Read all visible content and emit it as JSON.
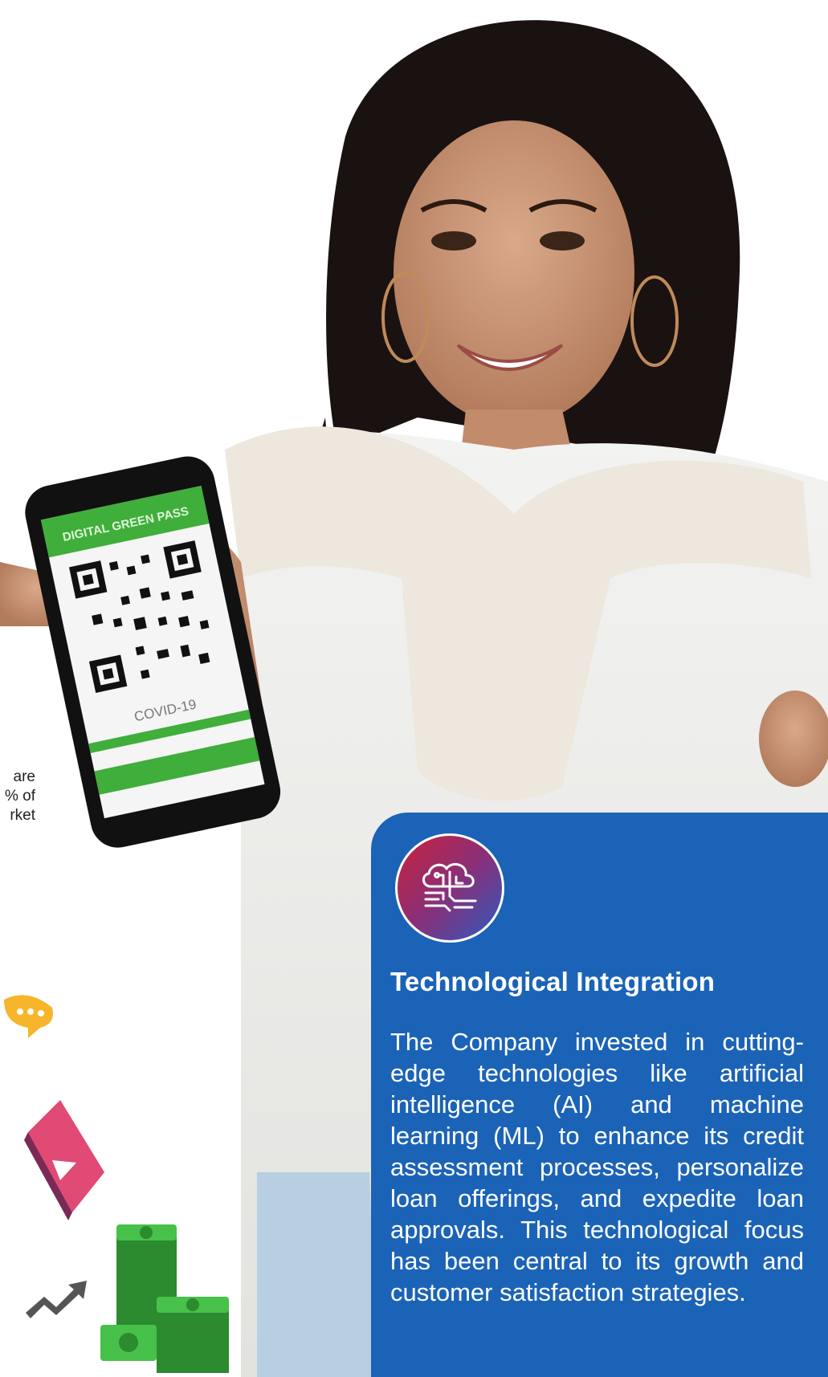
{
  "left_fragment": {
    "lines": [
      "are",
      "% of",
      "rket"
    ]
  },
  "phone": {
    "header": "DIGITAL GREEN PASS",
    "label": "COVID-19"
  },
  "card": {
    "icon": "cloud-circuit-icon",
    "title": "Technological Integration",
    "body": "The Company invested in cutting-edge technologies like artificial intelligence (AI) and machine learning (ML) to enhance its credit assessment processes, personalize loan offerings, and expedite loan approvals. This technological focus has been central to its growth and customer satisfaction strategies.",
    "background": "#1b63b7"
  },
  "colors": {
    "accent_blue": "#1b63b7",
    "green": "#3fae3a"
  }
}
